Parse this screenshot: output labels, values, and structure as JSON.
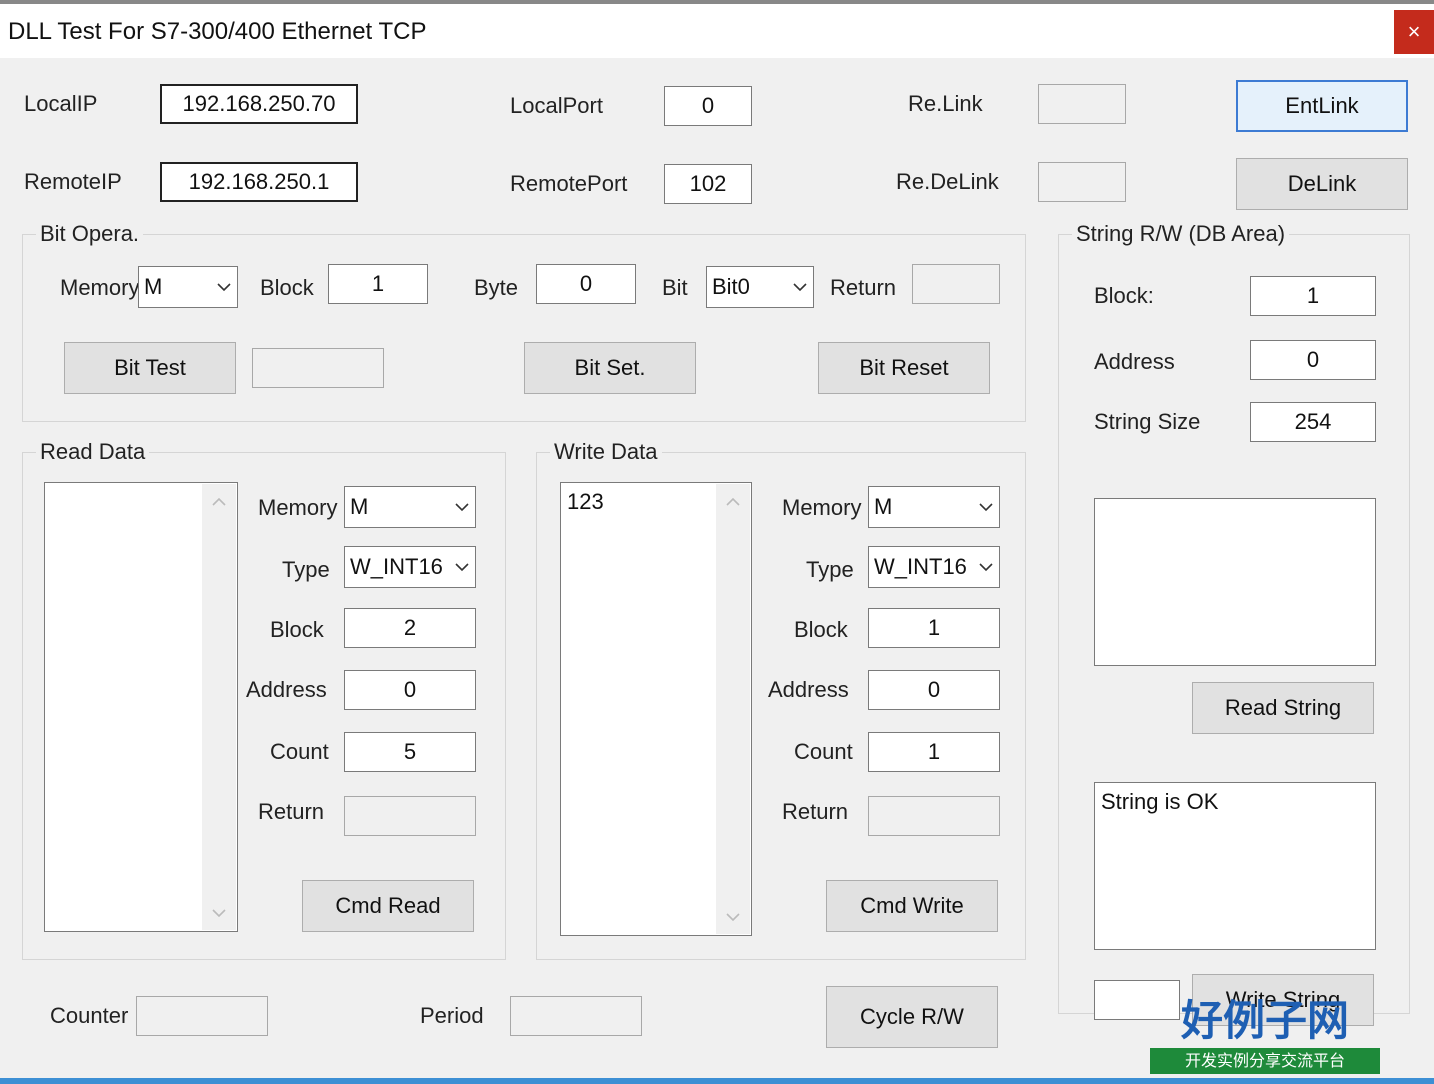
{
  "window": {
    "title": "DLL Test For S7-300/400 Ethernet TCP",
    "close_glyph": "×"
  },
  "connection": {
    "local_ip_label": "LocalIP",
    "local_ip": "192.168.250.70",
    "remote_ip_label": "RemoteIP",
    "remote_ip": "192.168.250.1",
    "local_port_label": "LocalPort",
    "local_port": "0",
    "remote_port_label": "RemotePort",
    "remote_port": "102",
    "relink_label": "Re.Link",
    "relink_value": "",
    "redelink_label": "Re.DeLink",
    "redelink_value": "",
    "entlink_button": "EntLink",
    "delink_button": "DeLink"
  },
  "bit_opera": {
    "title": "Bit Opera.",
    "memory_label": "Memory",
    "memory_value": "M",
    "block_label": "Block",
    "block_value": "1",
    "byte_label": "Byte",
    "byte_value": "0",
    "bit_label": "Bit",
    "bit_value": "Bit0",
    "return_label": "Return",
    "return_value": "",
    "bit_test_button": "Bit Test",
    "bit_test_result": "",
    "bit_set_button": "Bit Set.",
    "bit_reset_button": "Bit Reset"
  },
  "read_data": {
    "title": "Read Data",
    "list_content": "",
    "memory_label": "Memory",
    "memory_value": "M",
    "type_label": "Type",
    "type_value": "W_INT16",
    "block_label": "Block",
    "block_value": "2",
    "address_label": "Address",
    "address_value": "0",
    "count_label": "Count",
    "count_value": "5",
    "return_label": "Return",
    "return_value": "",
    "cmd_button": "Cmd Read"
  },
  "write_data": {
    "title": "Write Data",
    "list_content": "123",
    "memory_label": "Memory",
    "memory_value": "M",
    "type_label": "Type",
    "type_value": "W_INT16",
    "block_label": "Block",
    "block_value": "1",
    "address_label": "Address",
    "address_value": "0",
    "count_label": "Count",
    "count_value": "1",
    "return_label": "Return",
    "return_value": "",
    "cmd_button": "Cmd Write"
  },
  "string_rw": {
    "title": "String R/W (DB Area)",
    "block_label": "Block:",
    "block_value": "1",
    "address_label": "Address",
    "address_value": "0",
    "size_label": "String Size",
    "size_value": "254",
    "read_area": "",
    "read_button": "Read String",
    "status_text": "String is OK",
    "write_input": "",
    "write_button": "Write String"
  },
  "footer": {
    "counter_label": "Counter",
    "counter_value": "",
    "period_label": "Period",
    "period_value": "",
    "cycle_button": "Cycle R/W"
  },
  "watermark": {
    "brand": "好例子网",
    "slogan": "开发实例分享交流平台"
  },
  "colors": {
    "accent": "#3d7bd3",
    "close": "#c42b1c",
    "background": "#f0f0f0"
  }
}
